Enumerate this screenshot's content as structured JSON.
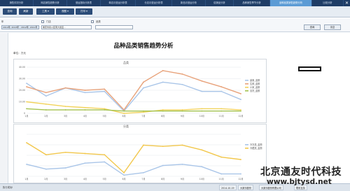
{
  "tabs": [
    {
      "label": "销售情况分析"
    },
    {
      "label": "网店销售趋势分析"
    },
    {
      "label": "营运指标分析表"
    },
    {
      "label": "单店月营运分析表"
    },
    {
      "label": "分店月营运分析表"
    },
    {
      "label": "新品月营运分析"
    },
    {
      "label": "促销品分析"
    },
    {
      "label": "品种销售季节分析"
    },
    {
      "label": "品种品类销售趋势分析"
    },
    {
      "label": "比较分析"
    }
  ],
  "toolbar": {
    "query_label": "查询",
    "refresh_label": "刷新",
    "tools_label": "工具",
    "view_label": "视图",
    "print_label": "打印"
  },
  "filters": {
    "year_label": "年",
    "year_value": "2014年, 2013年 - 2012年, 2011年",
    "store_label": "门店",
    "store_value": "重庆市永川区南大街店...",
    "category_label": "品类",
    "category_value": ""
  },
  "actions": {
    "query_label": "查询",
    "clear_label": "清空"
  },
  "report": {
    "title": "品种品类销售趋势分析",
    "unit": "单位：万元"
  },
  "chart_data": [
    {
      "type": "line",
      "title": "品类",
      "categories": [
        "1月",
        "2月",
        "3月",
        "4月",
        "5月",
        "6月",
        "7月",
        "8月",
        "9月",
        "10月",
        "11月",
        "12月"
      ],
      "ylim": [
        0,
        40
      ],
      "yticks": [
        "0",
        "10.00",
        "20.00",
        "30.00",
        "40.00"
      ],
      "legend_position": "right",
      "series": [
        {
          "name": "副食_金额",
          "color": "#a9c5e8",
          "values": [
            26,
            15,
            22,
            18,
            19,
            2,
            22,
            27,
            25,
            19,
            19,
            12
          ]
        },
        {
          "name": "生鲜_金额",
          "color": "#e8a27a",
          "values": [
            23,
            18,
            22,
            20,
            21,
            3,
            27,
            37,
            34,
            28,
            23,
            17
          ]
        },
        {
          "name": "小家_金额",
          "color": "#f2d35b",
          "values": [
            10,
            8,
            6,
            5,
            4,
            0,
            1,
            3,
            3,
            4,
            4,
            3
          ]
        },
        {
          "name": "百货_金额",
          "color": "#a3c24f",
          "values": [
            4,
            3,
            3,
            3,
            3,
            2,
            2,
            2,
            2,
            2,
            2,
            2
          ]
        }
      ]
    },
    {
      "type": "line",
      "title": "分类",
      "categories": [
        "1月",
        "2月",
        "3月",
        "4月",
        "5月",
        "6月",
        "7月",
        "8月",
        "9月",
        "10月",
        "11月",
        "12月"
      ],
      "ylim": [
        0,
        3.5
      ],
      "legend_position": "right",
      "series": [
        {
          "name": "冷冻类_金额",
          "color": "#a9c5e8",
          "values": [
            1.0,
            0.6,
            0.7,
            1.1,
            1.2,
            0.1,
            0.3,
            0.9,
            1.0,
            0.8,
            0.2,
            0.2
          ]
        },
        {
          "name": "冷藏类_金额",
          "color": "#f2c74b",
          "values": [
            2.8,
            1.8,
            2.0,
            1.9,
            1.8,
            0.3,
            2.6,
            2.5,
            2.6,
            2.2,
            1.6,
            1.4
          ]
        }
      ]
    }
  ],
  "status": {
    "left": "执行成功!",
    "date": "2014-10-19",
    "user": "大家乐股份",
    "company": "大家乐股份有限公司",
    "extra": "联系支持"
  },
  "watermark": {
    "name": "北京通友时代科技",
    "url": "www.bjtysd.net"
  }
}
